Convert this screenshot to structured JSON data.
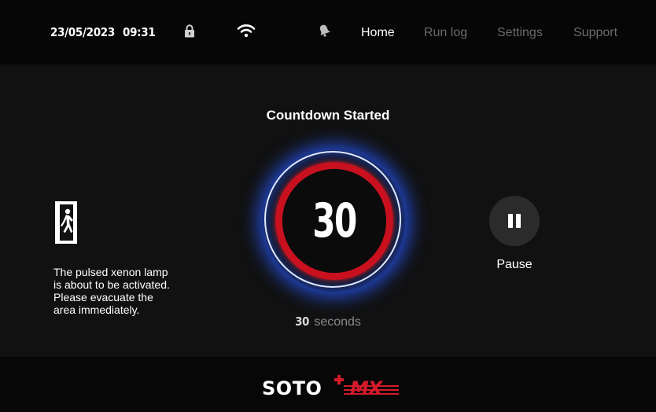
{
  "status_bar": {
    "date": "23/05/2023",
    "time": "09:31",
    "icons": [
      "lock-icon",
      "wifi-icon",
      "bell-icon"
    ]
  },
  "nav": {
    "items": [
      {
        "label": "Home",
        "active": true
      },
      {
        "label": "Run log",
        "active": false
      },
      {
        "label": "Settings",
        "active": false
      },
      {
        "label": "Support",
        "active": false
      }
    ]
  },
  "main": {
    "title": "Countdown Started",
    "countdown_value": "30",
    "seconds_value": "30",
    "seconds_label": "seconds",
    "warning_lines": [
      "The pulsed xenon lamp",
      "is about to be activated.",
      "Please evacuate the",
      "area immediately."
    ],
    "exit_icon": "emergency-exit-icon",
    "pause_icon": "pause-icon",
    "pause_label": "Pause"
  },
  "footer": {
    "logo_text": "SOTO",
    "logo_suffix": "MX"
  },
  "colors": {
    "accent_red": "#c8101e",
    "glow_blue": "#285aff",
    "nav_inactive": "#6b6b6b",
    "background": "#111111"
  }
}
